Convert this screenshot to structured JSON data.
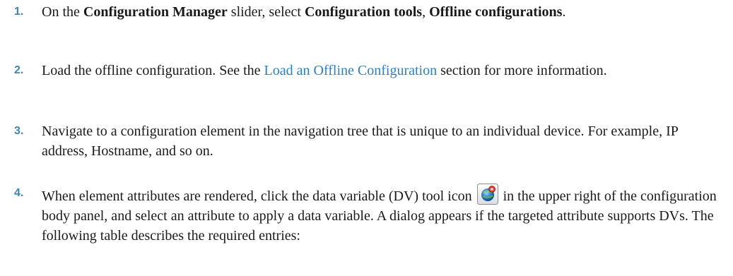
{
  "steps": [
    {
      "number": "1.",
      "t1": "On the ",
      "b1": "Configuration Manager",
      "t2": " slider, select ",
      "b2": "Configuration tools",
      "t3": ", ",
      "b3": "Offline configurations",
      "t4": "."
    },
    {
      "number": "2.",
      "t1": "Load the offline configuration. See the ",
      "link": "Load an Offline Configuration",
      "t2": " section for more information."
    },
    {
      "number": "3.",
      "text": "Navigate to a configuration element in the navigation tree that is unique to an individual device. For example, IP address, Hostname, and so on."
    },
    {
      "number": "4.",
      "t1": "When element attributes are rendered, click the data variable (DV) tool icon ",
      "icon": "dv-tool-icon",
      "t2": " in the upper right of the configuration body panel, and select an attribute to apply a data variable. A dialog appears if the targeted attribute supports DVs. The following table describes the required entries:"
    }
  ],
  "colors": {
    "number": "#3a87b6",
    "link": "#2a7fd0",
    "text": "#1a1a1a"
  }
}
